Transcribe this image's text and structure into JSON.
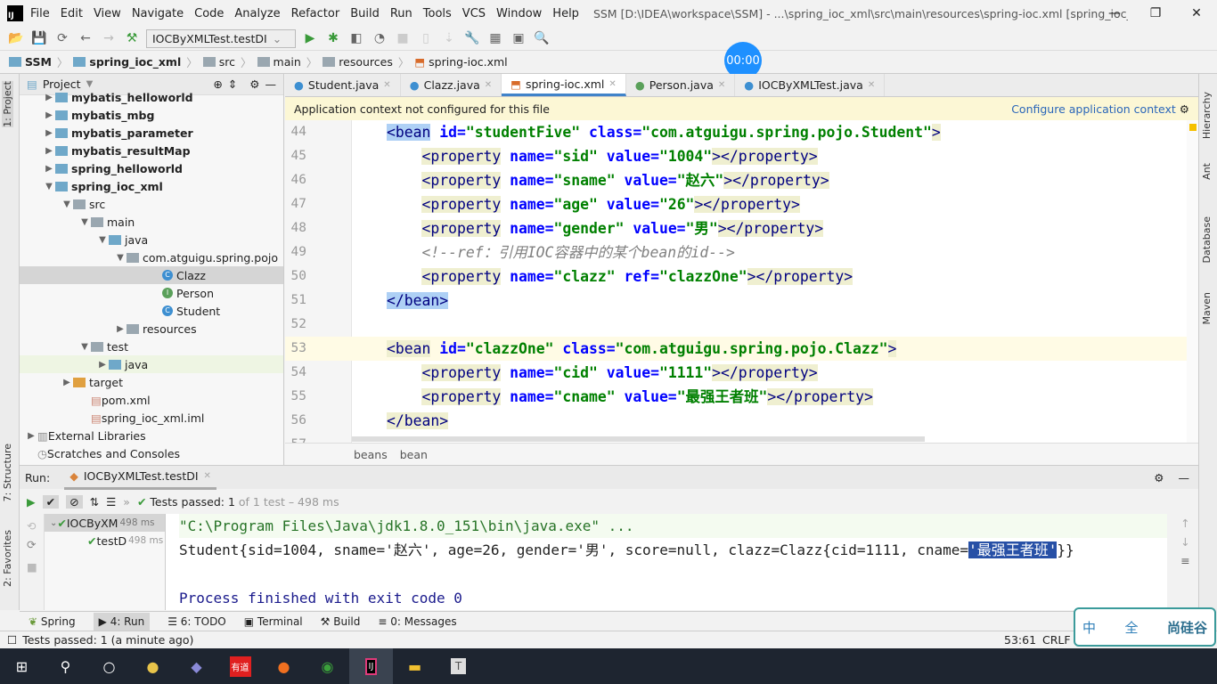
{
  "menubar": {
    "items": [
      "File",
      "Edit",
      "View",
      "Navigate",
      "Code",
      "Analyze",
      "Refactor",
      "Build",
      "Run",
      "Tools",
      "VCS",
      "Window",
      "Help"
    ],
    "title": "SSM [D:\\IDEA\\workspace\\SSM] - ...\\spring_ioc_xml\\src\\main\\resources\\spring-ioc.xml [spring_ioc_xml] - IntelliJ IDEA"
  },
  "toolbar": {
    "run_config": "IOCByXMLTest.testDI"
  },
  "navbar": {
    "crumbs": [
      "SSM",
      "spring_ioc_xml",
      "src",
      "main",
      "resources",
      "spring-ioc.xml"
    ]
  },
  "timer": "00:00",
  "left_stripe": {
    "project": "1: Project",
    "structure": "7: Structure",
    "favorites": "2: Favorites"
  },
  "right_stripe": {
    "hierarchy": "Hierarchy",
    "ant": "Ant",
    "database": "Database",
    "maven": "Maven"
  },
  "project": {
    "title": "Project",
    "tree": [
      {
        "label": "mybatis_helloworld",
        "bold": true,
        "depth": 1,
        "arrow": "▶"
      },
      {
        "label": "mybatis_mbg",
        "bold": true,
        "depth": 1,
        "arrow": "▶"
      },
      {
        "label": "mybatis_parameter",
        "bold": true,
        "depth": 1,
        "arrow": "▶"
      },
      {
        "label": "mybatis_resultMap",
        "bold": true,
        "depth": 1,
        "arrow": "▶"
      },
      {
        "label": "spring_helloworld",
        "bold": true,
        "depth": 1,
        "arrow": "▶"
      },
      {
        "label": "spring_ioc_xml",
        "bold": true,
        "depth": 1,
        "arrow": "▼"
      },
      {
        "label": "src",
        "depth": 2,
        "arrow": "▼"
      },
      {
        "label": "main",
        "depth": 3,
        "arrow": "▼"
      },
      {
        "label": "java",
        "depth": 4,
        "arrow": "▼"
      },
      {
        "label": "com.atguigu.spring.pojo",
        "depth": 5,
        "arrow": "▼"
      },
      {
        "label": "Clazz",
        "depth": 7,
        "kind": "class"
      },
      {
        "label": "Person",
        "depth": 7,
        "kind": "interface"
      },
      {
        "label": "Student",
        "depth": 7,
        "kind": "class"
      },
      {
        "label": "resources",
        "depth": 5,
        "arrow": "▶"
      },
      {
        "label": "test",
        "depth": 3,
        "arrow": "▼"
      },
      {
        "label": "java",
        "depth": 4,
        "arrow": "▶"
      },
      {
        "label": "target",
        "depth": 2,
        "arrow": "▶"
      },
      {
        "label": "pom.xml",
        "depth": 3
      },
      {
        "label": "spring_ioc_xml.iml",
        "depth": 3
      },
      {
        "label": "External Libraries",
        "depth": 0,
        "arrow": "▶"
      },
      {
        "label": "Scratches and Consoles",
        "depth": 0
      }
    ]
  },
  "tabs": [
    {
      "label": "Student.java"
    },
    {
      "label": "Clazz.java"
    },
    {
      "label": "spring-ioc.xml",
      "active": true
    },
    {
      "label": "Person.java"
    },
    {
      "label": "IOCByXMLTest.java"
    }
  ],
  "notification": {
    "text": "Application context not configured for this file",
    "link": "Configure application context"
  },
  "code": [
    {
      "n": "44",
      "t": [
        [
          "tag",
          "<bean",
          1
        ],
        [
          "plain",
          " "
        ],
        [
          "attr",
          "id="
        ],
        [
          "str",
          "\"studentFive\""
        ],
        [
          "plain",
          " "
        ],
        [
          "attr",
          "class="
        ],
        [
          "str",
          "\"com.atguigu.spring.pojo.Student\""
        ],
        [
          "tag",
          ">"
        ]
      ]
    },
    {
      "n": "45",
      "t": [
        [
          "plain",
          "    "
        ],
        [
          "tag",
          "<property"
        ],
        [
          "plain",
          " "
        ],
        [
          "attr",
          "name="
        ],
        [
          "str",
          "\"sid\""
        ],
        [
          "plain",
          " "
        ],
        [
          "attr",
          "value="
        ],
        [
          "str",
          "\"1004\""
        ],
        [
          "tag",
          "></property>"
        ]
      ]
    },
    {
      "n": "46",
      "t": [
        [
          "plain",
          "    "
        ],
        [
          "tag",
          "<property"
        ],
        [
          "plain",
          " "
        ],
        [
          "attr",
          "name="
        ],
        [
          "str",
          "\"sname\""
        ],
        [
          "plain",
          " "
        ],
        [
          "attr",
          "value="
        ],
        [
          "str",
          "\"赵六\""
        ],
        [
          "tag",
          "></property>"
        ]
      ]
    },
    {
      "n": "47",
      "t": [
        [
          "plain",
          "    "
        ],
        [
          "tag",
          "<property"
        ],
        [
          "plain",
          " "
        ],
        [
          "attr",
          "name="
        ],
        [
          "str",
          "\"age\""
        ],
        [
          "plain",
          " "
        ],
        [
          "attr",
          "value="
        ],
        [
          "str",
          "\"26\""
        ],
        [
          "tag",
          "></property>"
        ]
      ]
    },
    {
      "n": "48",
      "t": [
        [
          "plain",
          "    "
        ],
        [
          "tag",
          "<property"
        ],
        [
          "plain",
          " "
        ],
        [
          "attr",
          "name="
        ],
        [
          "str",
          "\"gender\""
        ],
        [
          "plain",
          " "
        ],
        [
          "attr",
          "value="
        ],
        [
          "str",
          "\"男\""
        ],
        [
          "tag",
          "></property>"
        ]
      ]
    },
    {
      "n": "49",
      "t": [
        [
          "plain",
          "    "
        ],
        [
          "cmt",
          "<!--ref：引用IOC容器中的某个bean的id-->"
        ]
      ]
    },
    {
      "n": "50",
      "t": [
        [
          "plain",
          "    "
        ],
        [
          "tag",
          "<property"
        ],
        [
          "plain",
          " "
        ],
        [
          "attr",
          "name="
        ],
        [
          "str",
          "\"clazz\""
        ],
        [
          "plain",
          " "
        ],
        [
          "attr",
          "ref="
        ],
        [
          "str",
          "\"clazzOne\""
        ],
        [
          "tag",
          "></property>"
        ]
      ]
    },
    {
      "n": "51",
      "t": [
        [
          "match",
          "</bean>"
        ]
      ]
    },
    {
      "n": "52",
      "t": []
    },
    {
      "n": "53",
      "cur": true,
      "t": [
        [
          "tag",
          "<bean"
        ],
        [
          "plain",
          " "
        ],
        [
          "attr",
          "id="
        ],
        [
          "str",
          "\"clazzOne\""
        ],
        [
          "plain",
          " "
        ],
        [
          "attr",
          "class="
        ],
        [
          "str",
          "\"com.atguigu.spring.pojo.Clazz\""
        ],
        [
          "tag",
          ">"
        ]
      ]
    },
    {
      "n": "54",
      "t": [
        [
          "plain",
          "    "
        ],
        [
          "tag",
          "<property"
        ],
        [
          "plain",
          " "
        ],
        [
          "attr",
          "name="
        ],
        [
          "str",
          "\"cid\""
        ],
        [
          "plain",
          " "
        ],
        [
          "attr",
          "value="
        ],
        [
          "str",
          "\"1111\""
        ],
        [
          "tag",
          "></property>"
        ]
      ]
    },
    {
      "n": "55",
      "t": [
        [
          "plain",
          "    "
        ],
        [
          "tag",
          "<property"
        ],
        [
          "plain",
          " "
        ],
        [
          "attr",
          "name="
        ],
        [
          "str",
          "\"cname\""
        ],
        [
          "plain",
          " "
        ],
        [
          "attr",
          "value="
        ],
        [
          "str",
          "\"最强王者班\""
        ],
        [
          "tag",
          "></property>"
        ]
      ]
    },
    {
      "n": "56",
      "t": [
        [
          "tag",
          "</bean>"
        ]
      ]
    },
    {
      "n": "57",
      "t": []
    }
  ],
  "editor_breadcrumb": [
    "beans",
    "bean"
  ],
  "run": {
    "label": "Run:",
    "tab": "IOCByXMLTest.testDI",
    "status_prefix": "Tests passed:",
    "status_count": "1",
    "status_suffix": "of 1 test – 498 ms",
    "tree": [
      {
        "label": "IOCByXM",
        "time": "498 ms"
      },
      {
        "label": "testD",
        "time": "498 ms"
      }
    ],
    "console": {
      "line1": "\"C:\\Program Files\\Java\\jdk1.8.0_151\\bin\\java.exe\" ...",
      "line2_pre": "Student{sid=1004, sname='赵六', age=26, gender='男', score=null, clazz=Clazz{cid=1111, cname=",
      "line2_sel": "'最强王者班'",
      "line2_post": "}}",
      "line4": "Process finished with exit code 0"
    }
  },
  "tool_windows": [
    "Spring",
    "4: Run",
    "6: TODO",
    "Terminal",
    "Build",
    "0: Messages"
  ],
  "status": {
    "message": "Tests passed: 1 (a minute ago)",
    "position": "53:61",
    "line_sep": "CRLF"
  },
  "ime": {
    "left": "中",
    "mid": "全",
    "brand": "尚硅谷"
  },
  "taskbar": {
    "apps": [
      "start-icon",
      "search-icon",
      "cortana-icon",
      "app-icon",
      "app-icon",
      "youdao-icon",
      "firefox-icon",
      "chrome-icon",
      "intellij-icon",
      "explorer-icon",
      "typora-icon"
    ],
    "youdao": "有道",
    "intellij": "IJ",
    "typora": "T"
  },
  "colors": {
    "accent": "#4083c9",
    "selection": "#2750a6",
    "notification_bg": "#fcf7d5",
    "taskbar": "#1e2530"
  }
}
